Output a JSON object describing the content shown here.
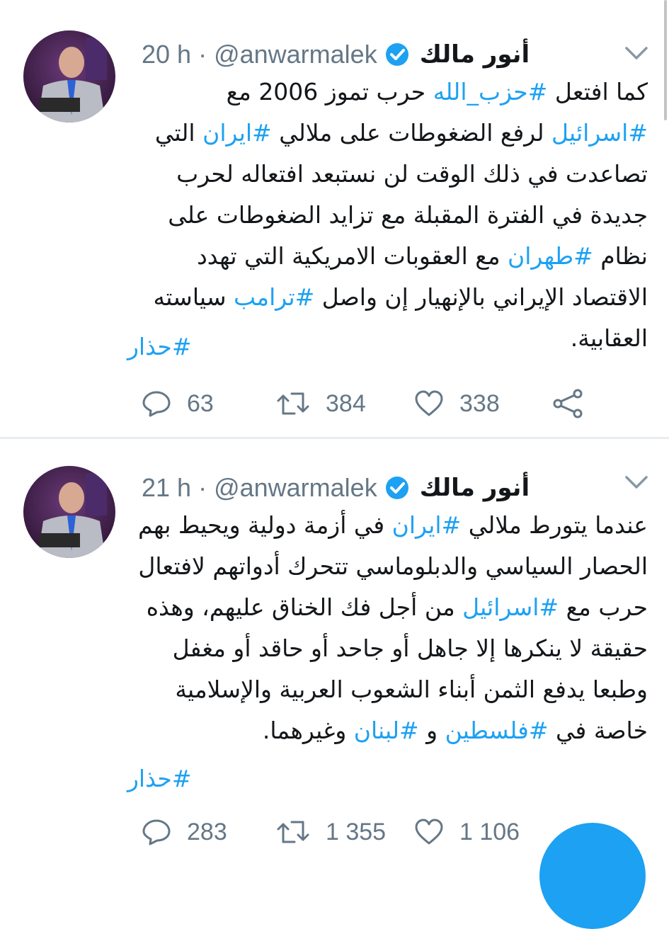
{
  "tweets": [
    {
      "author_name": "أنور مالك",
      "handle": "@anwarmalek",
      "separator": "·",
      "time": "20 h",
      "text_segments": [
        {
          "t": "كما افتعل ",
          "h": false
        },
        {
          "t": "#حزب_الله",
          "h": true
        },
        {
          "t": " حرب تموز 2006 مع ",
          "h": false
        },
        {
          "t": "#اسرائيل",
          "h": true
        },
        {
          "t": " لرفع الضغوطات على ملالي ",
          "h": false
        },
        {
          "t": "#ايران",
          "h": true
        },
        {
          "t": " التي تصاعدت في ذلك الوقت لن نستبعد افتعاله لحرب جديدة في الفترة المقبلة مع تزايد الضغوطات على نظام ",
          "h": false
        },
        {
          "t": "#طهران",
          "h": true
        },
        {
          "t": " مع العقوبات الامريكية التي تهدد الاقتصاد الإيراني بالإنهيار إن واصل ",
          "h": false
        },
        {
          "t": "#ترامب",
          "h": true
        },
        {
          "t": " سياسته العقابية.",
          "h": false
        }
      ],
      "tag": "#حذار",
      "replies": "63",
      "retweets": "384",
      "likes": "338"
    },
    {
      "author_name": "أنور مالك",
      "handle": "@anwarmalek",
      "separator": "·",
      "time": "21 h",
      "text_segments": [
        {
          "t": "عندما يتورط ملالي ",
          "h": false
        },
        {
          "t": "#ايران",
          "h": true
        },
        {
          "t": " في أزمة دولية ويحيط بهم الحصار السياسي والدبلوماسي تتحرك أدواتهم لافتعال حرب مع ",
          "h": false
        },
        {
          "t": "#اسرائيل",
          "h": true
        },
        {
          "t": " من أجل فك الخناق عليهم، وهذه حقيقة لا ينكرها إلا جاهل أو جاحد أو حاقد أو مغفل وطبعا يدفع الثمن أبناء الشعوب العربية والإسلامية خاصة في ",
          "h": false
        },
        {
          "t": "#فلسطين",
          "h": true
        },
        {
          "t": " و ",
          "h": false
        },
        {
          "t": "#لبنان",
          "h": true
        },
        {
          "t": " وغيرهما.",
          "h": false
        }
      ],
      "tag": "#حذار",
      "replies": "283",
      "retweets": "1 355",
      "likes": "1 106"
    }
  ],
  "icons": {
    "reply": "reply-icon",
    "retweet": "retweet-icon",
    "like": "heart-icon",
    "share": "share-icon",
    "verified": "verified-badge-icon",
    "menu": "chevron-down-icon",
    "compose": "compose-fab"
  },
  "colors": {
    "link": "#1da1f2",
    "meta": "#657786",
    "text": "#14171a",
    "divider": "#e6ecf0"
  }
}
